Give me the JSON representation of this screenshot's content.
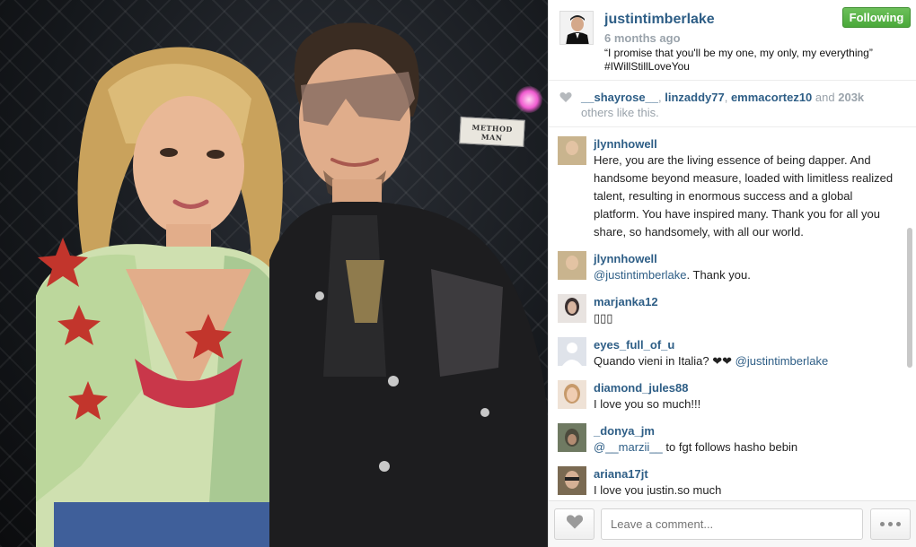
{
  "post": {
    "author": "justintimberlake",
    "time": "6 months ago",
    "caption_line1": "“I promise that you'll be my one, my only, my everything”",
    "caption_line2": "#IWillStillLoveYou",
    "follow_label": "Following",
    "sign_text_1": "METHOD",
    "sign_text_2": "MAN"
  },
  "likes": {
    "user1": "__shayrose__",
    "user2": "linzaddy77",
    "user3": "emmacortez10",
    "and_label": "and",
    "count": "203k",
    "others_label": "others like this."
  },
  "comments": [
    {
      "user": "jlynnhowell",
      "text": "Here, you are the living essence of being dapper. And handsome beyond measure, loaded with limitless realized talent, resulting in enormous success and a global platform. You have inspired many. Thank you for all you share, so handsomely, with all our world.",
      "avatar": "#c9b48e"
    },
    {
      "user": "jlynnhowell",
      "mention": "@justintimberlake",
      "text": ". Thank you.",
      "avatar": "#c9b48e"
    },
    {
      "user": "marjanka12",
      "text": "▯▯▯",
      "avatar": "#3a3030"
    },
    {
      "user": "eyes_full_of_u",
      "text": "Quando vieni in Italia? ❤❤",
      "mention": " @justintimberlake",
      "avatar": "#d6dbe4"
    },
    {
      "user": "diamond_jules88",
      "text": "I love you so much!!!",
      "avatar": "#d7b79a"
    },
    {
      "user": "_donya_jm",
      "mention": "@__marzii__",
      "text": " to fgt follows hasho bebin",
      "avatar": "#4c4a3c"
    },
    {
      "user": "ariana17jt",
      "text": "I love you justin.so much",
      "avatar": "#7a6a52"
    }
  ],
  "footer": {
    "comment_placeholder": "Leave a comment..."
  },
  "colors": {
    "link": "#2e5e86",
    "following_green": "#4aa83a",
    "meta_gray": "#9aa3ab"
  },
  "icons": [
    "heart-icon",
    "more-dots-icon"
  ]
}
